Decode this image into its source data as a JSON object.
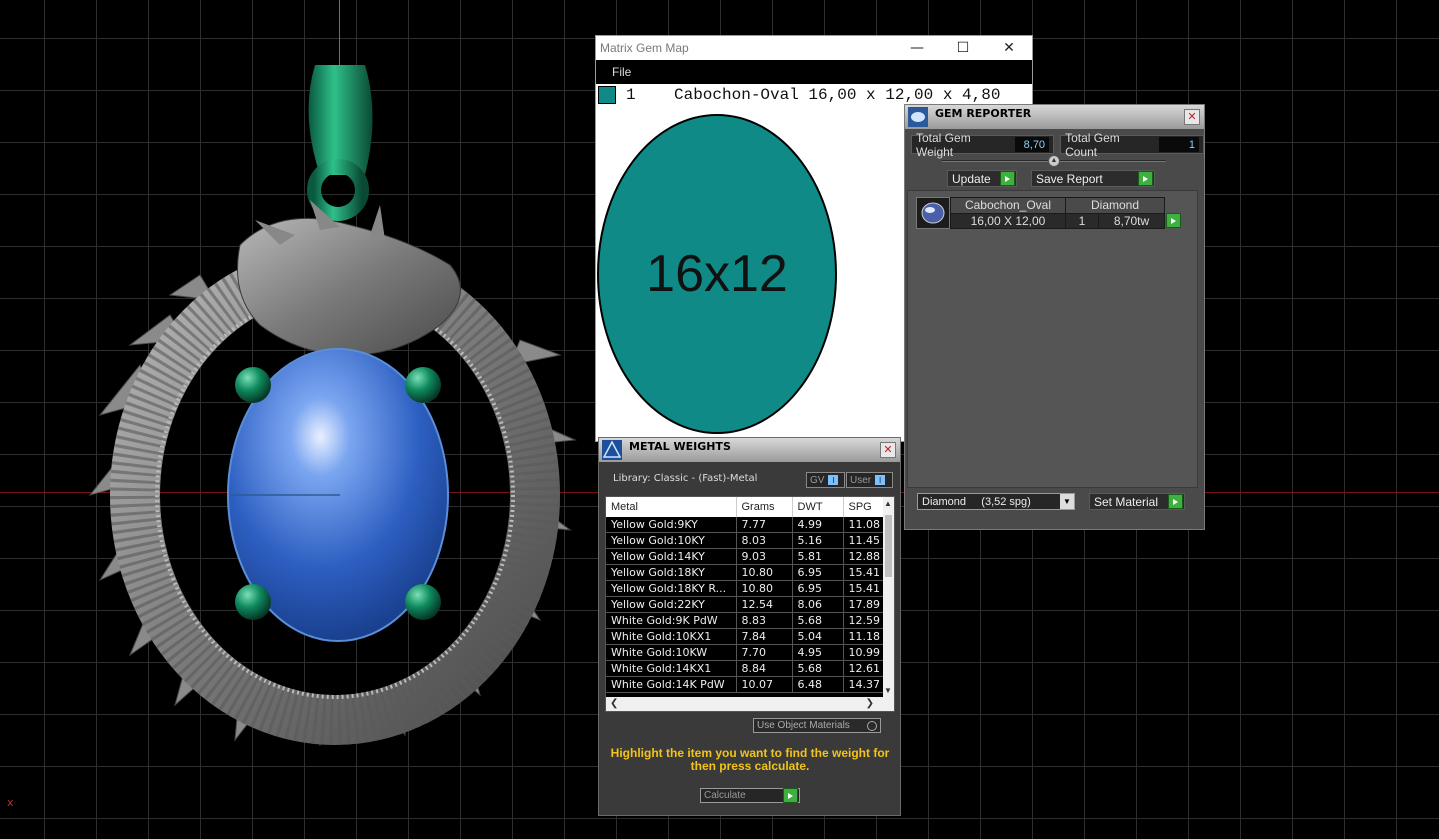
{
  "viewport": {
    "axis_label": "x"
  },
  "gem_map": {
    "title": "Matrix Gem Map",
    "menu": {
      "file": "File"
    },
    "row": {
      "index": "1",
      "description": "Cabochon-Oval 16,00 x 12,00 x 4,80"
    },
    "oval_label": "16x12",
    "colors": {
      "gem": "#0f8a86"
    }
  },
  "gem_reporter": {
    "title": "GEM REPORTER",
    "total_weight_label": "Total Gem Weight",
    "total_weight_value": "8,70",
    "total_count_label": "Total Gem Count",
    "total_count_value": "1",
    "update_label": "Update",
    "save_report_label": "Save Report",
    "item": {
      "shape": "Cabochon_Oval",
      "material": "Diamond",
      "size": "16,00 X 12,00",
      "count": "1",
      "weight": "8,70tw"
    },
    "material_select": "Diamond     (3,52 spg)",
    "set_material_label": "Set Material"
  },
  "metal_weights": {
    "title": "METAL WEIGHTS",
    "library": "Library: Classic - (Fast)-Metal",
    "gv_label": "GV",
    "user_label": "User",
    "columns": [
      "Metal",
      "Grams",
      "DWT",
      "SPG"
    ],
    "rows": [
      [
        "Yellow Gold:9KY",
        "7.77",
        "4.99",
        "11.08"
      ],
      [
        "Yellow Gold:10KY",
        "8.03",
        "5.16",
        "11.45"
      ],
      [
        "Yellow Gold:14KY",
        "9.03",
        "5.81",
        "12.88"
      ],
      [
        "Yellow Gold:18KY",
        "10.80",
        "6.95",
        "15.41"
      ],
      [
        "Yellow Gold:18KY R...",
        "10.80",
        "6.95",
        "15.41"
      ],
      [
        "Yellow Gold:22KY",
        "12.54",
        "8.06",
        "17.89"
      ],
      [
        "White Gold:9K PdW",
        "8.83",
        "5.68",
        "12.59"
      ],
      [
        "White Gold:10KX1",
        "7.84",
        "5.04",
        "11.18"
      ],
      [
        "White Gold:10KW",
        "7.70",
        "4.95",
        "10.99"
      ],
      [
        "White Gold:14KX1",
        "8.84",
        "5.68",
        "12.61"
      ],
      [
        "White Gold:14K PdW",
        "10.07",
        "6.48",
        "14.37"
      ]
    ],
    "use_object_materials": "Use Object Materials",
    "hint": "Highlight the item you want to find the weight for then press calculate.",
    "calculate_label": "Calculate"
  }
}
